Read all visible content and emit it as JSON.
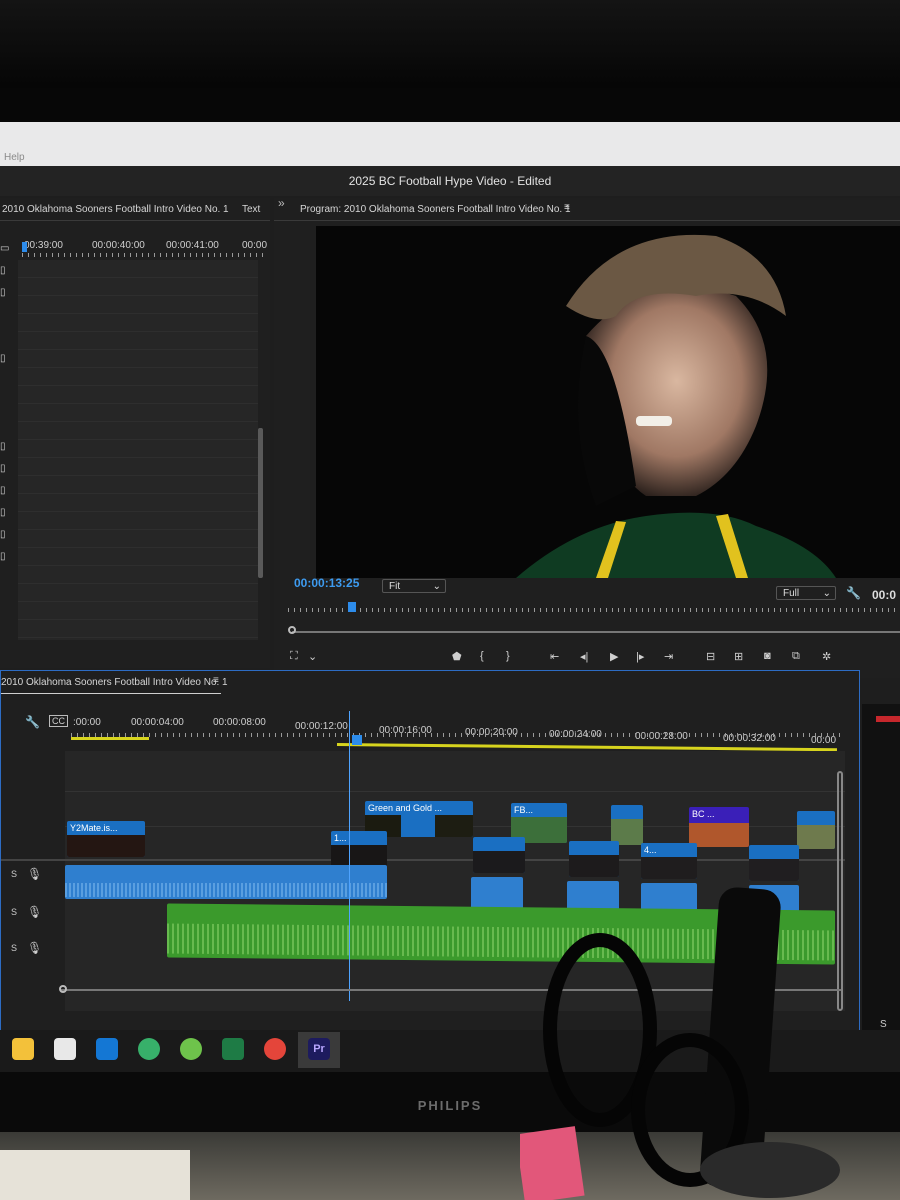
{
  "menu": {
    "help": "Help"
  },
  "app": {
    "title": "2025 BC Football Hype Video - Edited"
  },
  "source": {
    "title": "2010 Oklahoma Sooners Football Intro Video No. 1",
    "tab_text": "Text",
    "ticks": [
      "00:39:00",
      "00:00:40:00",
      "00:00:41:00",
      "00:00"
    ]
  },
  "program": {
    "title": "Program: 2010 Oklahoma Sooners Football Intro Video No. 1",
    "timecode": "00:00:13:25",
    "fit": "Fit",
    "quality": "Full",
    "duration_partial": "00:0"
  },
  "timeline": {
    "title": "2010 Oklahoma Sooners Football Intro Video No. 1",
    "ticks": [
      ":00:00",
      "00:00:04:00",
      "00:00:08:00",
      "00:00:12:00",
      "00:00:16:00",
      "00:00:20:00",
      "00:00:24:00",
      "00:00:28:00",
      "00:00:32:00",
      "00:00"
    ],
    "clips": {
      "green_gold": "Green and Gold ...",
      "fb": "FB...",
      "bc": "BC ...",
      "y2mate": "Y2Mate.is...",
      "c1": "1...",
      "c4": "4..."
    },
    "track_labels": [
      "S",
      "S",
      "S"
    ]
  },
  "icons": [
    "filter-icon",
    "insert-icon",
    "export-icon",
    "marker-icon",
    "in-icon",
    "out-icon",
    "go-to-in-icon",
    "step-back-icon",
    "play-icon",
    "step-forward-icon",
    "go-to-out-icon",
    "lift-icon",
    "extract-icon",
    "camera-icon",
    "compare-icon",
    "settings-icon",
    "wrench-icon",
    "mic-icon"
  ],
  "taskbar": {
    "apps": [
      "file-explorer",
      "calendar",
      "outlook",
      "edge",
      "onedrive",
      "excel",
      "chrome",
      "premiere-pro"
    ],
    "premiere_label": "Pr"
  },
  "monitor": {
    "brand": "PHILIPS"
  },
  "colors": {
    "accent": "#2d8ceb",
    "audio_green": "#3b9a2c",
    "clip_blue": "#1a6fc2",
    "yellow_bar": "#d7d41e"
  }
}
